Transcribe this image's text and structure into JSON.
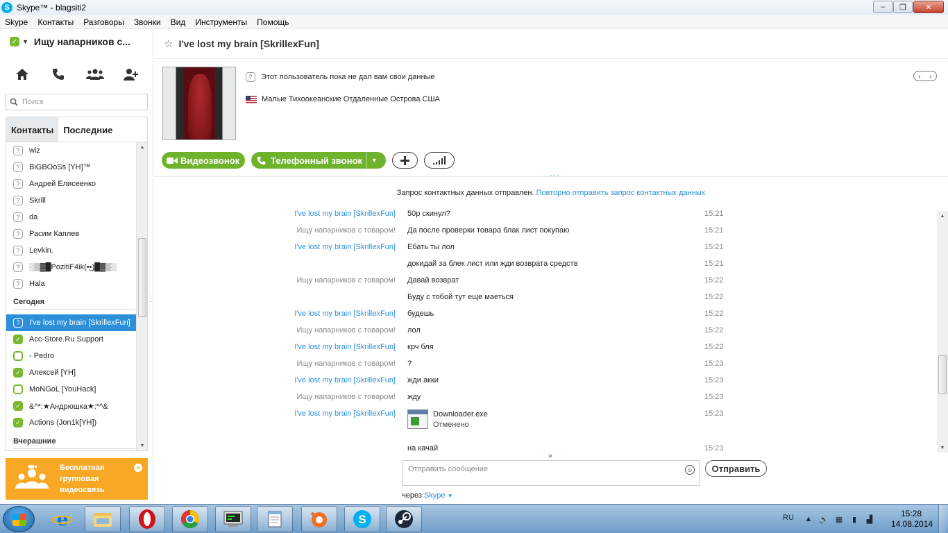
{
  "window": {
    "title": "Skype™ - blagsiti2",
    "app_icon": "S"
  },
  "menu": [
    "Skype",
    "Контакты",
    "Разговоры",
    "Звонки",
    "Вид",
    "Инструменты",
    "Помощь"
  ],
  "sidebar": {
    "status_name": "Ищу напарников с...",
    "search_placeholder": "Поиск",
    "tabs": [
      "Контакты",
      "Последние"
    ],
    "contacts_top": [
      {
        "name": "wiz",
        "status": "unknown"
      },
      {
        "name": "BiGBOoSs [YH]™",
        "status": "unknown"
      },
      {
        "name": "Андрей   Елисеенко",
        "status": "unknown"
      },
      {
        "name": "Skrill",
        "status": "unknown"
      },
      {
        "name": "da",
        "status": "unknown"
      },
      {
        "name": "Расим Каплев",
        "status": "unknown"
      },
      {
        "name": "Levkin.",
        "status": "unknown"
      },
      {
        "name": "░▒▓█PozitiF4ik(•͜•)█▓▒░",
        "status": "unknown"
      },
      {
        "name": "Hala",
        "status": "unknown"
      }
    ],
    "group_today": "Сегодня",
    "contacts_today": [
      {
        "name": "I've lost my brain [SkrillexFun]",
        "status": "unknown",
        "selected": true
      },
      {
        "name": "Acc-Store.Ru Support",
        "status": "online"
      },
      {
        "name": "- Pedro",
        "status": "away"
      },
      {
        "name": "Алексей [YH]",
        "status": "online"
      },
      {
        "name": "MoNGoL [YouHack]",
        "status": "away"
      },
      {
        "name": "&^*:★Андрюшка★:*^&",
        "status": "online"
      },
      {
        "name": "Actions (Jon1k[YH])",
        "status": "online"
      }
    ],
    "group_yesterday": "Вчерашние",
    "promo": {
      "line1": "Бесплатная",
      "line2": "групповая",
      "line3": "видеосвязь"
    }
  },
  "conversation": {
    "contact_name": "I've lost my brain [SkrillexFun]",
    "mood": "Этот пользователь пока не дал вам свои данные",
    "location": "Малые Тихоокеанские Отдаленные Острова США",
    "video_call": "Видеозвонок",
    "phone_call": "Телефонный звонок",
    "request_text": "Запрос контактных данных отправлен.",
    "request_link": "Повторно отправить запрос контактных данных",
    "messages": [
      {
        "who": "I've lost my brain [SkrillexFun]",
        "side": "them",
        "text": "50р скинул?",
        "time": "15:21"
      },
      {
        "who": "Ищу напарников с товаром!",
        "side": "me",
        "text": "Да после проверки товара блак лист покупаю",
        "time": "15:21"
      },
      {
        "who": "I've lost my brain [SkrillexFun]",
        "side": "them",
        "text": "Ебать ты лол",
        "time": "15:21"
      },
      {
        "who": "",
        "side": "them",
        "text": "докидай за блек лист или жди возврата средств",
        "time": "15:21"
      },
      {
        "who": "Ищу напарников с товаром!",
        "side": "me",
        "text": "Давай возврат",
        "time": "15:22"
      },
      {
        "who": "",
        "side": "me",
        "text": "Буду с тобой тут еще маеться",
        "time": "15:22"
      },
      {
        "who": "I've lost my brain [SkrillexFun]",
        "side": "them",
        "text": "будешь",
        "time": "15:22"
      },
      {
        "who": "Ищу напарников с товаром!",
        "side": "me",
        "text": "лол",
        "time": "15:22"
      },
      {
        "who": "I've lost my brain [SkrillexFun]",
        "side": "them",
        "text": "крч бля",
        "time": "15:22"
      },
      {
        "who": "Ищу напарников с товаром!",
        "side": "me",
        "text": "?",
        "time": "15:23"
      },
      {
        "who": "I've lost my brain [SkrillexFun]",
        "side": "them",
        "text": "жди акки",
        "time": "15:23"
      },
      {
        "who": "Ищу напарников с товаром!",
        "side": "me",
        "text": "жду",
        "time": "15:23"
      }
    ],
    "file_message": {
      "who": "I've lost my brain [SkrillexFun]",
      "file_name": "Downloader.exe",
      "file_status": "Отменено",
      "time": "15:23"
    },
    "last_message": {
      "who": "",
      "text": "на качай",
      "time": "15:23"
    },
    "compose_placeholder": "Отправить сообщение",
    "send_label": "Отправить",
    "via_label": "через",
    "via_link": "Skype"
  },
  "taskbar": {
    "lang": "RU",
    "time": "15:28",
    "date": "14.08.2014",
    "apps": [
      "internet-explorer-icon",
      "explorer-icon",
      "opera-icon",
      "chrome-icon",
      "terminal-icon",
      "notepad-icon",
      "avast-icon",
      "skype-icon",
      "steam-icon"
    ]
  },
  "colors": {
    "skype_blue": "#00aff0",
    "link": "#2b8fd9",
    "call_green": "#6fb22c",
    "promo_orange": "#f8a825"
  }
}
